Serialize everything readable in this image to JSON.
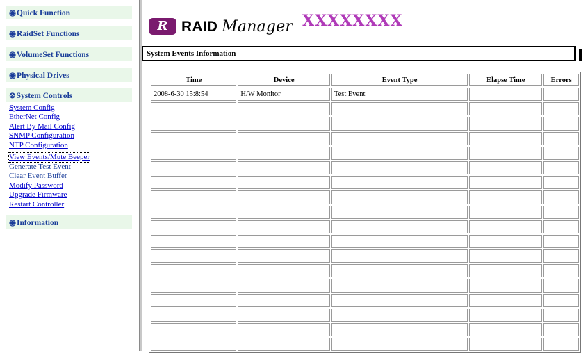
{
  "sidebar": {
    "sections": {
      "quick": "Quick Function",
      "raidset": "RaidSet Functions",
      "volumeset": "VolumeSet Functions",
      "physical": "Physical Drives",
      "system": "System Controls",
      "information": "Information"
    },
    "system_items": [
      {
        "label": "System Config",
        "style": "link"
      },
      {
        "label": "EtherNet Config",
        "style": "link"
      },
      {
        "label": "Alert By Mail Config",
        "style": "link"
      },
      {
        "label": "SNMP Configuration",
        "style": "link"
      },
      {
        "label": "NTP Configuration",
        "style": "link"
      },
      {
        "label": "View Events/Mute Beeper",
        "style": "focused"
      },
      {
        "label": "Generate Test Event",
        "style": "plain"
      },
      {
        "label": "Clear Event Buffer",
        "style": "plain"
      },
      {
        "label": "Modify Password",
        "style": "link"
      },
      {
        "label": "Upgrade Firmware",
        "style": "link"
      },
      {
        "label": "Restart Controller",
        "style": "link"
      }
    ]
  },
  "header": {
    "logo_badge": "R",
    "logo_word": "RAID",
    "logo_script": "Manager",
    "model": "XXXXXXXX"
  },
  "panel": {
    "title": "System Events Information"
  },
  "events_table": {
    "columns": [
      "Time",
      "Device",
      "Event Type",
      "Elapse Time",
      "Errors"
    ],
    "rows": [
      [
        "2008-6-30 15:8:54",
        "H/W Monitor",
        "Test Event",
        "",
        ""
      ],
      [
        "",
        "",
        "",
        "",
        ""
      ],
      [
        "",
        "",
        "",
        "",
        ""
      ],
      [
        "",
        "",
        "",
        "",
        ""
      ],
      [
        "",
        "",
        "",
        "",
        ""
      ],
      [
        "",
        "",
        "",
        "",
        ""
      ],
      [
        "",
        "",
        "",
        "",
        ""
      ],
      [
        "",
        "",
        "",
        "",
        ""
      ],
      [
        "",
        "",
        "",
        "",
        ""
      ],
      [
        "",
        "",
        "",
        "",
        ""
      ],
      [
        "",
        "",
        "",
        "",
        ""
      ],
      [
        "",
        "",
        "",
        "",
        ""
      ],
      [
        "",
        "",
        "",
        "",
        ""
      ],
      [
        "",
        "",
        "",
        "",
        ""
      ],
      [
        "",
        "",
        "",
        "",
        ""
      ],
      [
        "",
        "",
        "",
        "",
        ""
      ],
      [
        "",
        "",
        "",
        "",
        ""
      ],
      [
        "",
        "",
        "",
        "",
        ""
      ]
    ]
  },
  "colors": {
    "section_bg": "#e9f7e9",
    "section_text": "#1a3d99",
    "link": "#0000cc",
    "model": "#b03ab8",
    "logo_badge": "#7a1a6e"
  }
}
